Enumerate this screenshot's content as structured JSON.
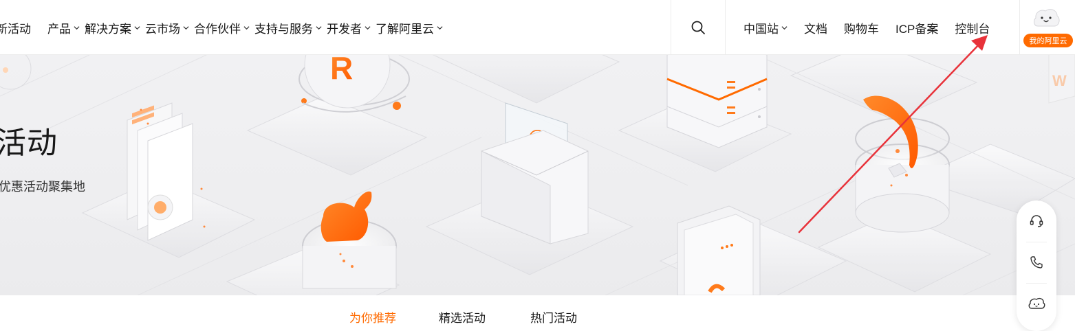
{
  "nav": {
    "items": [
      {
        "label": "新活动",
        "has_dropdown": false
      },
      {
        "label": "产品",
        "has_dropdown": true
      },
      {
        "label": "解决方案",
        "has_dropdown": true
      },
      {
        "label": "云市场",
        "has_dropdown": true
      },
      {
        "label": "合作伙伴",
        "has_dropdown": true
      },
      {
        "label": "支持与服务",
        "has_dropdown": true
      },
      {
        "label": "开发者",
        "has_dropdown": true
      },
      {
        "label": "了解阿里云",
        "has_dropdown": true
      }
    ],
    "search_icon": "search-icon",
    "right_items": [
      {
        "label": "中国站",
        "has_dropdown": true
      },
      {
        "label": "文档",
        "has_dropdown": false
      },
      {
        "label": "购物车",
        "has_dropdown": false
      },
      {
        "label": "ICP备案",
        "has_dropdown": false
      },
      {
        "label": "控制台",
        "has_dropdown": false
      }
    ],
    "my_aliyun_label": "我的阿里云"
  },
  "banner": {
    "title": "活动",
    "subtitle": "优惠活动聚集地"
  },
  "tabs": [
    {
      "label": "为你推荐",
      "active": true
    },
    {
      "label": "精选活动",
      "active": false
    },
    {
      "label": "热门活动",
      "active": false
    }
  ],
  "floatbar": {
    "icons": [
      "headset-icon",
      "phone-icon",
      "chat-bot-icon"
    ]
  },
  "colors": {
    "accent": "#ff6a00",
    "annotation_arrow": "#e8323a"
  }
}
